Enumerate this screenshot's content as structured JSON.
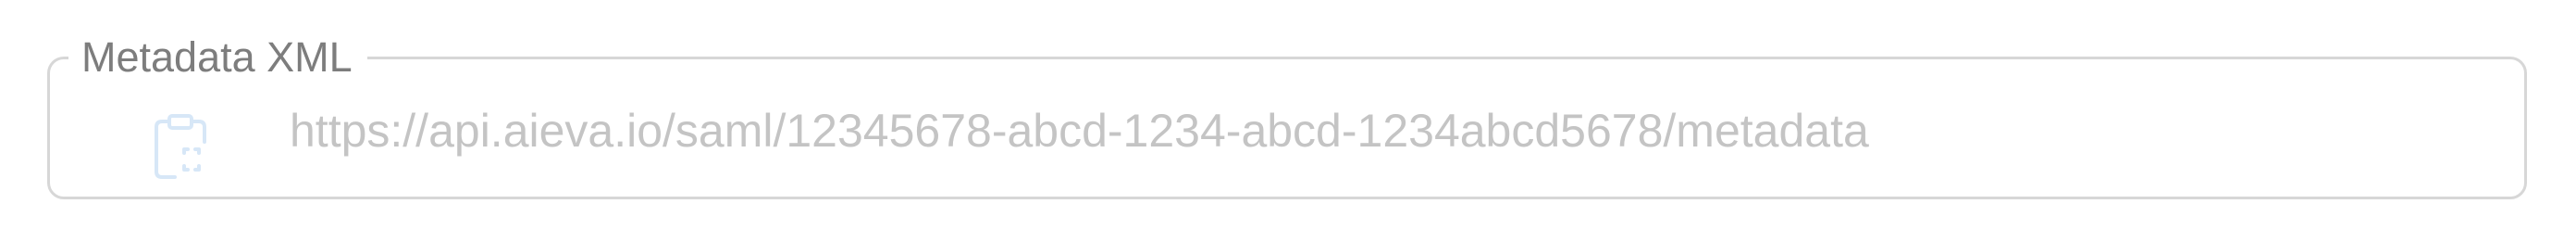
{
  "field": {
    "label": "Metadata XML",
    "value": "https://api.aieva.io/saml/12345678-abcd-1234-abcd-1234abcd5678/metadata",
    "copy_icon": "clipboard-copy-icon"
  },
  "colors": {
    "border": "#d7d7d7",
    "label": "#7d7d7d",
    "value_text": "#c4c4c4",
    "icon": "#d7e7f7"
  }
}
